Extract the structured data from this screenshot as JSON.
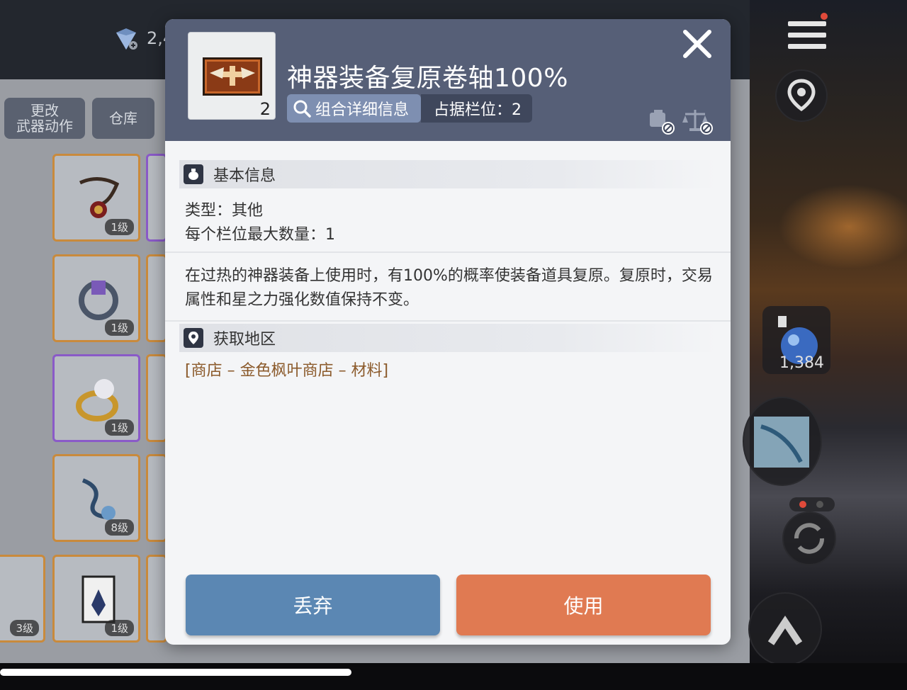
{
  "background": {
    "gem_count": "2,4",
    "tabs": [
      {
        "label": "更改\n武器动作"
      },
      {
        "label": "仓库"
      }
    ],
    "inventory_levels": [
      "1级",
      "1级",
      "1级",
      "8级",
      "1级",
      "3级"
    ],
    "potion_count": "1,384"
  },
  "modal": {
    "item_title": "神器装备复原卷轴100%",
    "item_quantity": "2",
    "detail_button": "组合详细信息",
    "slot_info": "占据栏位：2",
    "basic_section_title": "基本信息",
    "type_line": "类型：其他",
    "max_stack_line": "每个栏位最大数量：1",
    "description": "在过热的神器装备上使用时，有100%的概率使装备道具复原。复原时，交易属性和星之力强化数值保持不变。",
    "source_section_title": "获取地区",
    "source_location": "[商店 – 金色枫叶商店 – 材料]",
    "discard_button": "丢弃",
    "use_button": "使用"
  },
  "colors": {
    "header_bg": "#565f77",
    "discard": "#5b87b3",
    "use": "#e07a52",
    "location_text": "#8b5a2b"
  },
  "icons": [
    "close-icon",
    "search-icon",
    "untradeable-icon",
    "balance-icon",
    "bag-icon",
    "map-pin-icon",
    "menu-icon",
    "gem-icon",
    "map-icon",
    "refresh-icon",
    "jump-icon"
  ]
}
